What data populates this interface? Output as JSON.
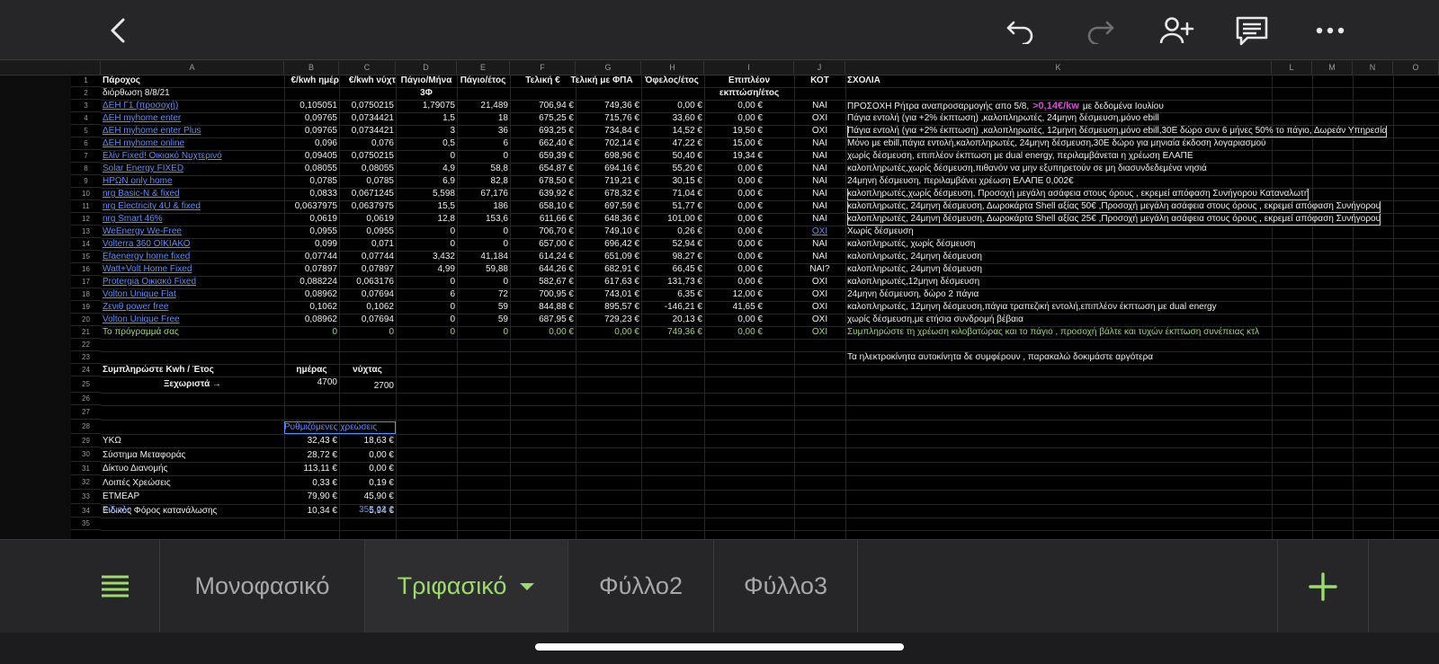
{
  "topbar": {
    "icons": [
      "back-icon",
      "undo-icon",
      "redo-icon",
      "add-person-icon",
      "comment-icon",
      "more-icon"
    ]
  },
  "columns": [
    "A",
    "B",
    "C",
    "D",
    "E",
    "F",
    "G",
    "H",
    "I",
    "J",
    "K",
    "L",
    "M",
    "N",
    "O"
  ],
  "rows": [
    "1",
    "2",
    "3",
    "4",
    "5",
    "6",
    "7",
    "8",
    "9",
    "10",
    "11",
    "12",
    "13",
    "14",
    "15",
    "16",
    "17",
    "18",
    "19",
    "20",
    "21",
    "22",
    "23",
    "24",
    "25",
    "26",
    "27",
    "28",
    "29",
    "30",
    "31",
    "32",
    "33",
    "34",
    "35"
  ],
  "header": {
    "a": "Πάροχος",
    "a2": "διόρθωση 8/8/21",
    "b": "€/kwh ημέρ",
    "c": "€/kwh νύχτ",
    "d": "Πάγιο/Μήνα",
    "d2": "3Φ",
    "e": "Πάγιο/έτος",
    "f": "Τελική €",
    "g": "Τελική με ΦΠΑ",
    "h": "Όφελος/έτος",
    "i": "Επιπλέον",
    "i2": "εκπτώση/έτος",
    "j": "ΚΟΤ",
    "k": "ΣΧΟΛΙΑ"
  },
  "providers": [
    {
      "a": "ΔΕΗ Γ1 (προσοχή)",
      "b": "0,105051",
      "c": "0,0750215",
      "d": "1,79075",
      "e": "21,489",
      "f": "706,94 €",
      "g": "749,36 €",
      "h": "0,00 €",
      "i": "0,00 €",
      "j": "ΝΑΙ",
      "k": "ΠΡΟΣΟΧΗ Ρήτρα αναπροσαρμογής απο 5/8,",
      "k_hl": ">0,14€/kw",
      "k_tail": "με δεδομένα Ιουλίου"
    },
    {
      "a": "ΔΕΗ myhome enter",
      "b": "0,09765",
      "c": "0,0734421",
      "d": "1,5",
      "e": "18",
      "f": "675,25 €",
      "g": "715,76 €",
      "h": "33,60 €",
      "i": "0,00 €",
      "j": "ΟΧΙ",
      "k": "Πάγια εντολή (για +2% έκπτωση) ,καλοπληρωτές, 24μηνη δέσμευση,μόνο ebill"
    },
    {
      "a": "ΔΕΗ myhome enter Plus",
      "b": "0,09765",
      "c": "0,0734421",
      "d": "3",
      "e": "36",
      "f": "693,25 €",
      "g": "734,84 €",
      "h": "14,52 €",
      "i": "19,50 €",
      "j": "ΟΧΙ",
      "k": "Πάγια εντολή (για +2% έκπτωση) ,καλοπληρωτές, 12μηνη δέσμευση,μόνο ebill,30Ε δώρο συν 6 μήνες 50% το πάγιο, Δωρεάν Υπηρεσία"
    },
    {
      "a": "ΔΕΗ myhome online",
      "b": "0,096",
      "c": "0,076",
      "d": "0,5",
      "e": "6",
      "f": "662,40 €",
      "g": "702,14 €",
      "h": "47,22 €",
      "i": "15,00 €",
      "j": "ΝΑΙ",
      "k": "Μόνο με ebill,πάγια εντολή,καλοπληρωτές, 24μηνη δέσμευση,30Ε δώρο για μηνιαία έκδοση λογαριασμού"
    },
    {
      "a": "Ελίν Fixed! Οικιακό Νυχτερινό",
      "b": "0,09405",
      "c": "0,0750215",
      "d": "0",
      "e": "0",
      "f": "659,39 €",
      "g": "698,96 €",
      "h": "50,40 €",
      "i": "19,34 €",
      "j": "ΝΑΙ",
      "k": "χωρίς δέσμευση, επιπλέον έκπτωση με dual energy, περιλαμβάνεται η χρέωση ΕΛΑΠΕ"
    },
    {
      "a": "Solar Energy FIXED",
      "b": "0,08055",
      "c": "0,08055",
      "d": "4,9",
      "e": "58,8",
      "f": "654,87 €",
      "g": "694,16 €",
      "h": "55,20 €",
      "i": "0,00 €",
      "j": "ΝΑΙ",
      "k": "καλοπληρωτές,χωρίς δέσμευση,πιθανόν να μην εξυπηρετούν σε μη διασυνδεδεμένα νησιά"
    },
    {
      "a": "ΗΡΩΝ only home",
      "b": "0,0785",
      "c": "0,0785",
      "d": "6,9",
      "e": "82,8",
      "f": "678,50 €",
      "g": "719,21 €",
      "h": "30,15 €",
      "i": "0,00 €",
      "j": "ΝΑΙ",
      "k": "24μηνη δέσμευση, περιλαμβάνει χρέωση ΕΛΑΠΕ 0,002€"
    },
    {
      "a": "nrg Basic-N & fixed",
      "b": "0,0833",
      "c": "0,0671245",
      "d": "5,598",
      "e": "67,176",
      "f": "639,92 €",
      "g": "678,32 €",
      "h": "71,04 €",
      "i": "0,00 €",
      "j": "ΝΑΙ",
      "k": "καλοπληρωτές,χωρίς δέσμευση, Προσοχή μεγάλη ασάφεια στους όρους , εκρεμεί απόφαση Συνήγορου Καταναλωτή"
    },
    {
      "a": "nrg Electricity 4U & fixed",
      "b": "0,0637975",
      "c": "0,0637975",
      "d": "15,5",
      "e": "186",
      "f": "658,10 €",
      "g": "697,59 €",
      "h": "51,77 €",
      "i": "0,00 €",
      "j": "ΝΑΙ",
      "k": "καλοπληρωτές, 24μηνη δέσμευση, Δωροκάρτα Shell αξίας 50€ ,Προσοχή μεγάλη ασάφεια στους όρους , εκρεμεί απόφαση Συνήγορου"
    },
    {
      "a": "nrg Smart 46%",
      "b": "0,0619",
      "c": "0,0619",
      "d": "12,8",
      "e": "153,6",
      "f": "611,66 €",
      "g": "648,36 €",
      "h": "101,00 €",
      "i": "0,00 €",
      "j": "ΝΑΙ",
      "k": "καλοπληρωτές, 24μηνη δέσμευση, Δωροκάρτα Shell αξίας 25€ ,Προσοχή μεγάλη ασάφεια στους όρους , εκρεμεί απόφαση Συνήγορου"
    },
    {
      "a": "WeEnergy We-Free",
      "b": "0,0955",
      "c": "0,0955",
      "d": "0",
      "e": "0",
      "f": "706,70 €",
      "g": "749,10 €",
      "h": "0,26 €",
      "i": "0,00 €",
      "j": "ΟΧΙ",
      "k": "Χωρίς δέσμευση"
    },
    {
      "a": "Volterra 360 ΟΙΚΙΑΚΟ",
      "b": "0,099",
      "c": "0,071",
      "d": "0",
      "e": "0",
      "f": "657,00 €",
      "g": "696,42 €",
      "h": "52,94 €",
      "i": "0,00 €",
      "j": "ΝΑΙ",
      "k": "καλοπληρωτές, χωρίς δέσμευση"
    },
    {
      "a": "Efaenergy home fixed",
      "b": "0,07744",
      "c": "0,07744",
      "d": "3,432",
      "e": "41,184",
      "f": "614,24 €",
      "g": "651,09 €",
      "h": "98,27 €",
      "i": "0,00 €",
      "j": "ΝΑΙ",
      "k": "καλοπληρωτές, 24μηνη δέσμευση"
    },
    {
      "a": "Watt+Volt Home Fixed",
      "b": "0,07897",
      "c": "0,07897",
      "d": "4,99",
      "e": "59,88",
      "f": "644,26 €",
      "g": "682,91 €",
      "h": "66,45 €",
      "i": "0,00 €",
      "j": "ΝΑΙ?",
      "k": "καλοπληρωτές, 24μηνη δέσμευση"
    },
    {
      "a": "Protergia Οικιακό Fixed",
      "b": "0,088224",
      "c": "0,063176",
      "d": "0",
      "e": "0",
      "f": "582,67 €",
      "g": "617,63 €",
      "h": "131,73 €",
      "i": "0,00 €",
      "j": "ΟΧΙ",
      "k": "καλοπληρωτές,12μηνη δέσμευση"
    },
    {
      "a": "Volton Unique Flat",
      "b": "0,08962",
      "c": "0,07694",
      "d": "6",
      "e": "72",
      "f": "700,95 €",
      "g": "743,01 €",
      "h": "6,35 €",
      "i": "12,00 €",
      "j": "ΟΧΙ",
      "k": "24μηνη δέσμευση, δώρο 2 πάγια"
    },
    {
      "a": "Ζενιθ power free",
      "b": "0,1062",
      "c": "0,1062",
      "d": "0",
      "e": "59",
      "f": "844,88 €",
      "g": "895,57 €",
      "h": "-146,21 €",
      "i": "41,65 €",
      "j": "ΟΧΙ",
      "k": "καλοπληρωτές, 12μηνη δέσμευση,πάγια τραπεζική εντολή,επιπλέον έκπτωση με dual energy"
    },
    {
      "a": "Volton Unique Free",
      "b": "0,08962",
      "c": "0,07694",
      "d": "0",
      "e": "59",
      "f": "687,95 €",
      "g": "729,23 €",
      "h": "20,13 €",
      "i": "0,00 €",
      "j": "ΟΧΙ",
      "k": "χωρίς δέσμευση,με ετήσια συνδρομή βέβαια"
    }
  ],
  "custom_row": {
    "a": "Το πρόγραμμά σας",
    "b": "0",
    "c": "0",
    "d": "0",
    "e": "0",
    "f": "0,00 €",
    "g": "0,00 €",
    "h": "749,36 €",
    "i": "0,00 €",
    "j": "ΟΧΙ",
    "k": "Συμπληρώστε τη χρέωση κιλοβατώρας και το πάγιο , προσοχή βάλτε και τυχών έκπτωση συνέπειας κτλ"
  },
  "note_row23": "Τα ηλεκτροκίνητα αυτοκίνητα δε συμφέρουν , παρακαλώ δοκιμάστε αργότερα",
  "kwh": {
    "label": "Συμπληρώστε Kwh / Έτος",
    "day_label": "ημέρας",
    "night_label": "νύχτας",
    "sep_label": "Ξεχωριστά →",
    "day": "4700",
    "night": "2700"
  },
  "charges_title": "Ρυθμιζόμενες χρεώσεις",
  "charges": [
    {
      "a": "ΥΚΩ",
      "b": "32,43 €",
      "c": "18,63 €"
    },
    {
      "a": "Σύστημα Μεταφοράς",
      "b": "28,72 €",
      "c": "0,00 €"
    },
    {
      "a": "Δίκτυο Διανομής",
      "b": "113,11 €",
      "c": "0,00 €"
    },
    {
      "a": "Λοιπές Χρεώσεις",
      "b": "0,33 €",
      "c": "0,19 €"
    },
    {
      "a": "ΕΤΜΕΑΡ",
      "b": "79,90 €",
      "c": "45,90 €"
    },
    {
      "a": "Ειδικός Φόρος κατανάλωσης",
      "b": "10,34 €",
      "c": "5,94 €"
    }
  ],
  "total": {
    "a": "Σύνολο",
    "c": "355,62 €"
  },
  "tabs": [
    "Μονοφασικό",
    "Τριφασικό",
    "Φύλλο2",
    "Φύλλο3"
  ],
  "active_tab": "Τριφασικό",
  "colors": {
    "accent": "#9adb6a",
    "link": "#5a8dff",
    "highlight": "#d54bd5"
  }
}
